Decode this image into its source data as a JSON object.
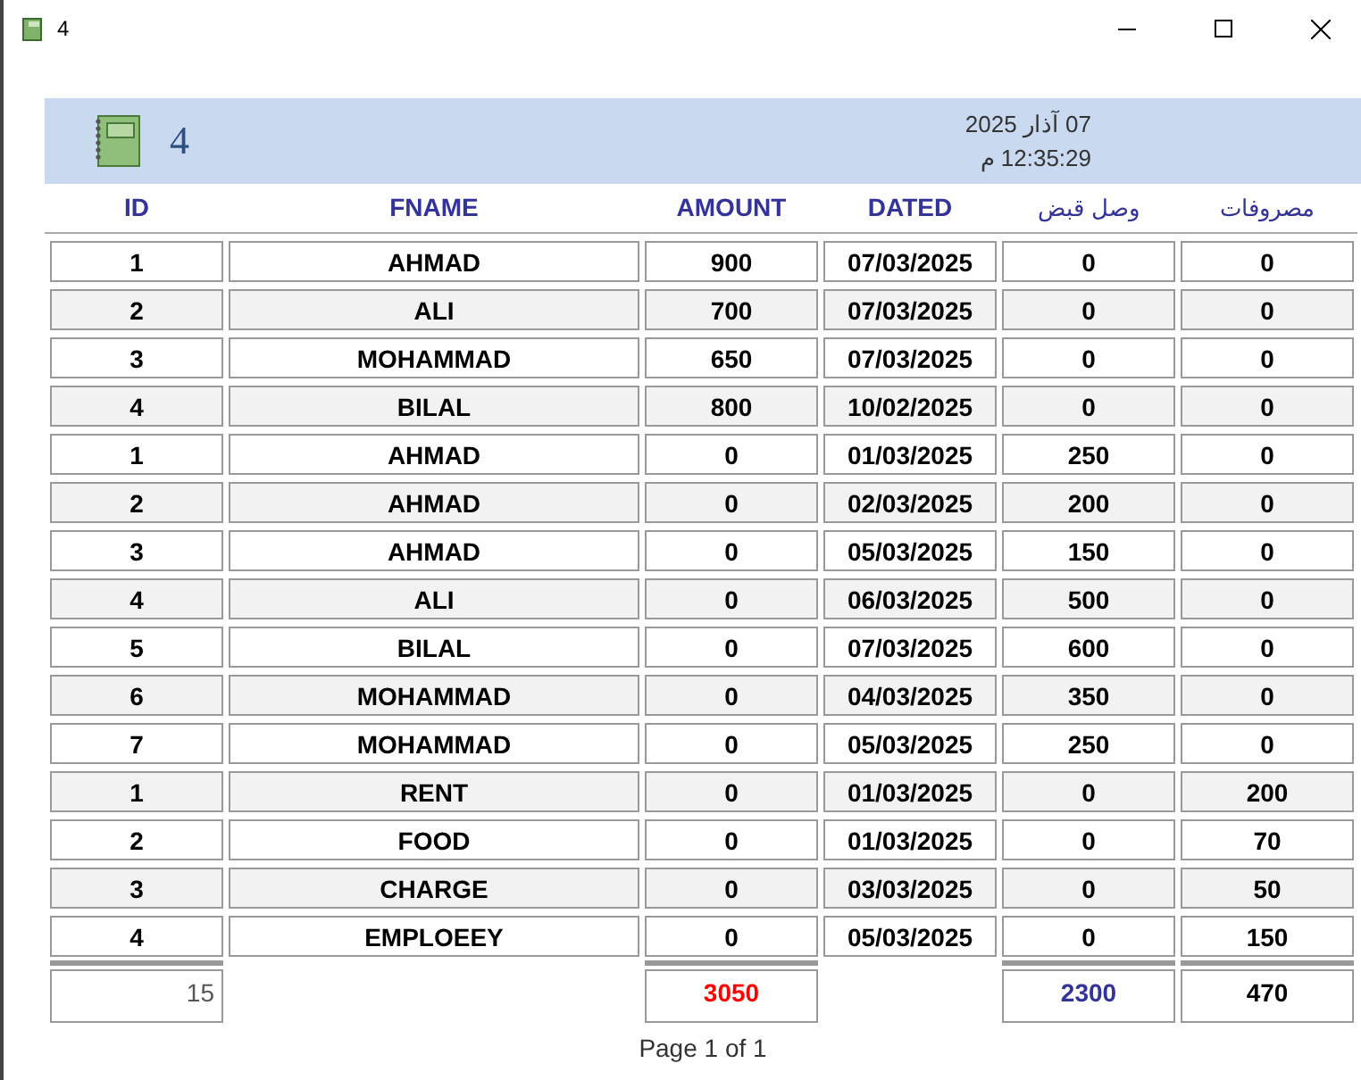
{
  "window": {
    "title": "4"
  },
  "header": {
    "title": "4",
    "date": "07 آذار 2025",
    "time": "12:35:29 م"
  },
  "columns": [
    "ID",
    "FNAME",
    "AMOUNT",
    "DATED",
    "وصل قبض",
    "مصروفات"
  ],
  "rows": [
    {
      "cells": [
        "1",
        "AHMAD",
        "900",
        "07/03/2025",
        "0",
        "0"
      ]
    },
    {
      "cells": [
        "2",
        "ALI",
        "700",
        "07/03/2025",
        "0",
        "0"
      ]
    },
    {
      "cells": [
        "3",
        "MOHAMMAD",
        "650",
        "07/03/2025",
        "0",
        "0"
      ]
    },
    {
      "cells": [
        "4",
        "BILAL",
        "800",
        "10/02/2025",
        "0",
        "0"
      ]
    },
    {
      "cells": [
        "1",
        "AHMAD",
        "0",
        "01/03/2025",
        "250",
        "0"
      ]
    },
    {
      "cells": [
        "2",
        "AHMAD",
        "0",
        "02/03/2025",
        "200",
        "0"
      ]
    },
    {
      "cells": [
        "3",
        "AHMAD",
        "0",
        "05/03/2025",
        "150",
        "0"
      ]
    },
    {
      "cells": [
        "4",
        "ALI",
        "0",
        "06/03/2025",
        "500",
        "0"
      ]
    },
    {
      "cells": [
        "5",
        "BILAL",
        "0",
        "07/03/2025",
        "600",
        "0"
      ]
    },
    {
      "cells": [
        "6",
        "MOHAMMAD",
        "0",
        "04/03/2025",
        "350",
        "0"
      ]
    },
    {
      "cells": [
        "7",
        "MOHAMMAD",
        "0",
        "05/03/2025",
        "250",
        "0"
      ]
    },
    {
      "cells": [
        "1",
        "RENT",
        "0",
        "01/03/2025",
        "0",
        "200"
      ]
    },
    {
      "cells": [
        "2",
        "FOOD",
        "0",
        "01/03/2025",
        "0",
        "70"
      ]
    },
    {
      "cells": [
        "3",
        "CHARGE",
        "0",
        "03/03/2025",
        "0",
        "50"
      ]
    },
    {
      "cells": [
        "4",
        "EMPLOEEY",
        "0",
        "05/03/2025",
        "0",
        "150"
      ]
    }
  ],
  "totals": {
    "id": {
      "value": "15",
      "color": "#555555"
    },
    "amount": {
      "value": "3050",
      "color": "#ff0000"
    },
    "receipt": {
      "value": "2300",
      "color": "#333399"
    },
    "expense": {
      "value": "470",
      "color": "#000000"
    }
  },
  "footer": "Page 1 of 1"
}
